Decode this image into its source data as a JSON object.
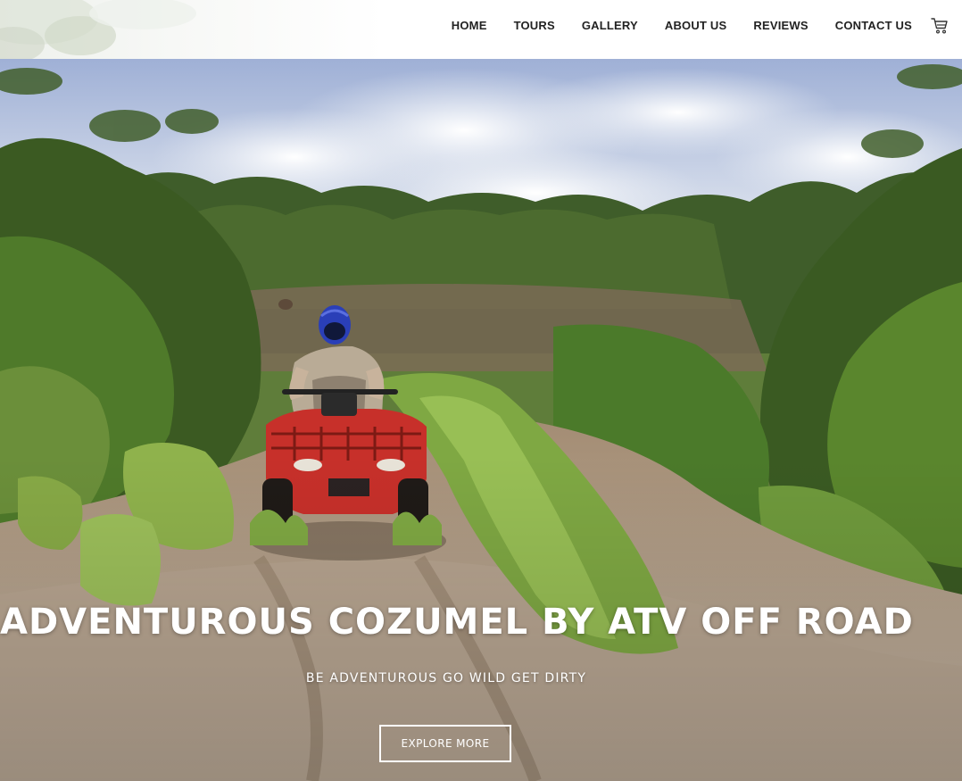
{
  "nav": {
    "items": [
      {
        "label": "HOME"
      },
      {
        "label": "TOURS"
      },
      {
        "label": "GALLERY"
      },
      {
        "label": "ABOUT US"
      },
      {
        "label": "REVIEWS"
      },
      {
        "label": "CONTACT US"
      }
    ],
    "cart_icon": "shopping-cart-icon"
  },
  "hero": {
    "title": "ADVENTUROUS COZUMEL BY ATV OFF ROAD",
    "subtitle": "BE ADVENTUROUS GO WILD GET DIRTY",
    "button_label": "EXPLORE MORE",
    "background": "photo: rider on red ATV on jungle dirt trail"
  },
  "colors": {
    "nav_text": "#222222",
    "header_bg": "#ffffff",
    "hero_text": "#ffffff",
    "atv_red": "#c7302a",
    "helmet_blue": "#2a3fb8"
  }
}
